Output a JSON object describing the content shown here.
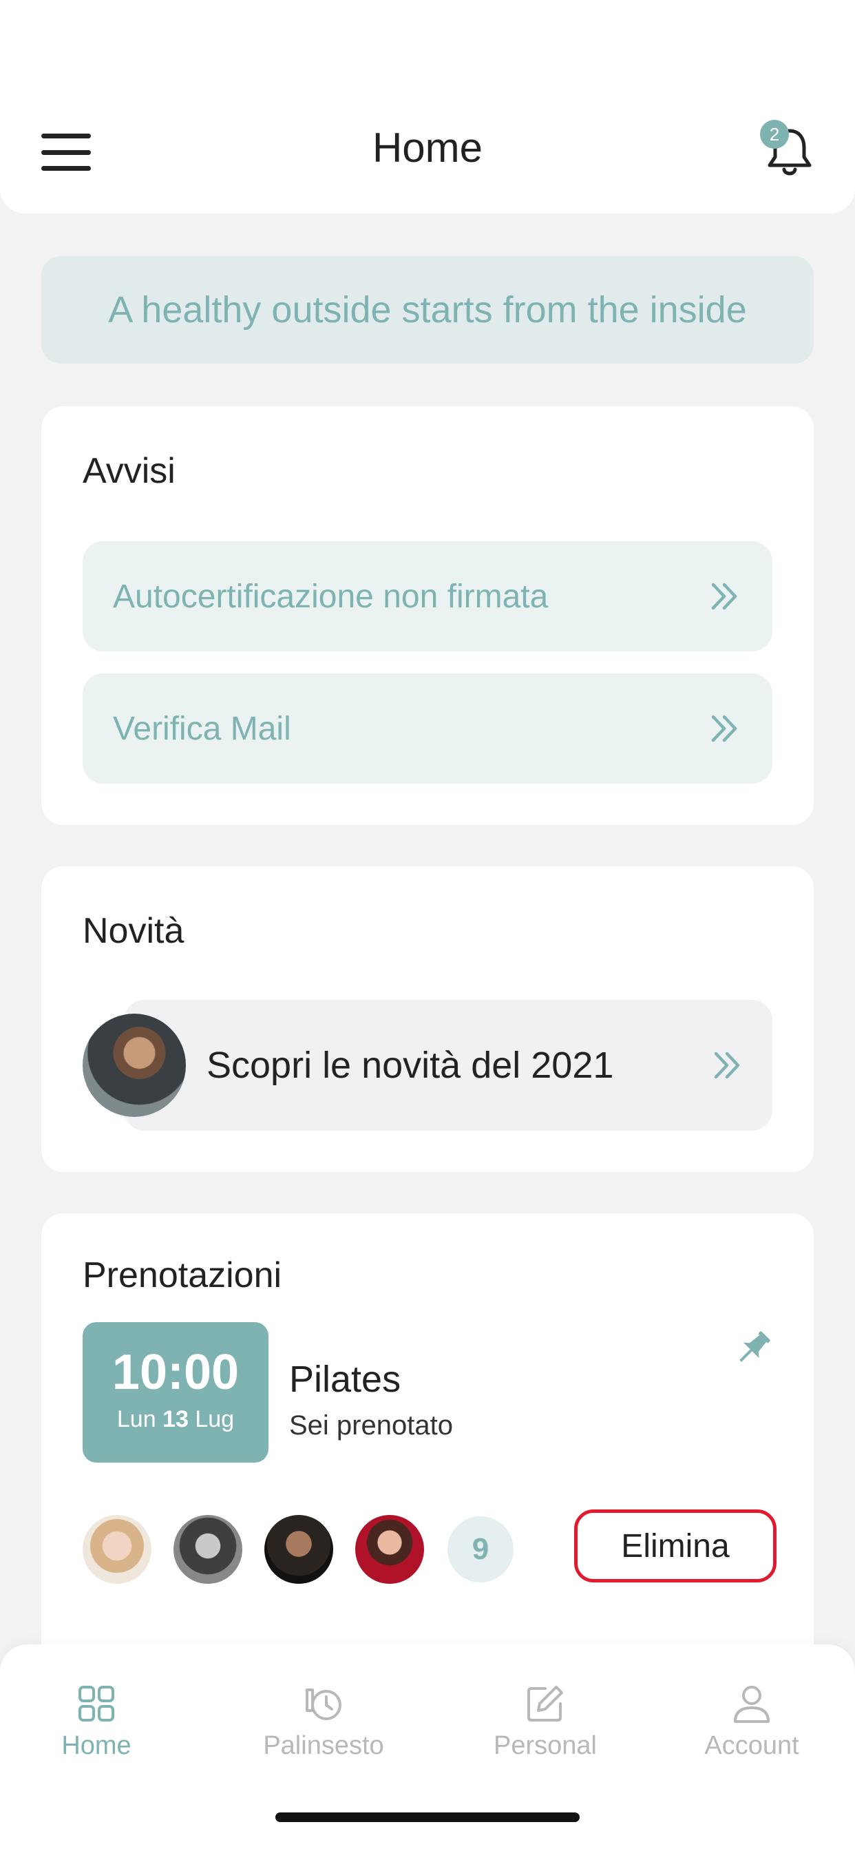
{
  "header": {
    "title": "Home",
    "notification_count": "2"
  },
  "banner": {
    "text": "A healthy outside starts from the inside"
  },
  "avvisi": {
    "title": "Avvisi",
    "items": [
      {
        "label": "Autocertificazione non firmata"
      },
      {
        "label": "Verifica Mail"
      }
    ]
  },
  "novita": {
    "title": "Novità",
    "item_label": "Scopri le novità del 2021"
  },
  "prenotazioni": {
    "title": "Prenotazioni",
    "time": "10:00",
    "day_name": "Lun",
    "day_num": "13",
    "month": "Lug",
    "class_name": "Pilates",
    "status": "Sei prenotato",
    "extra_participants": "9",
    "delete_label": "Elimina"
  },
  "tabbar": {
    "tabs": [
      {
        "label": "Home",
        "icon": "grid-icon",
        "active": true
      },
      {
        "label": "Palinsesto",
        "icon": "history-icon",
        "active": false
      },
      {
        "label": "Personal",
        "icon": "edit-icon",
        "active": false
      },
      {
        "label": "Account",
        "icon": "user-icon",
        "active": false
      }
    ]
  },
  "colors": {
    "accent": "#7fb3b2",
    "delete_border": "#e01b2f",
    "inactive_tab": "#b8b8bc"
  }
}
